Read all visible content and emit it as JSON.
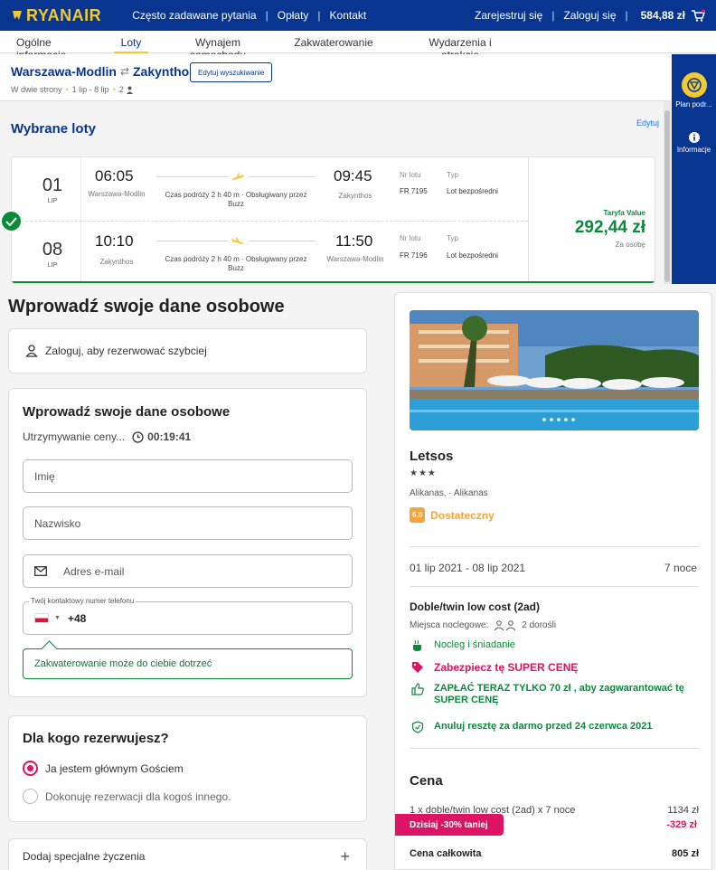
{
  "brand": {
    "name": "RYANAIR",
    "yellow": "#f1c933",
    "blue": "#073590"
  },
  "topnav": {
    "faq": "Często zadawane pytania",
    "fees": "Opłaty",
    "contact": "Kontakt",
    "register": "Zarejestruj się",
    "login": "Zaloguj się",
    "basket_total": "584,88 zł"
  },
  "tabs": [
    {
      "label": "Ogólne informacje"
    },
    {
      "label": "Loty"
    },
    {
      "label": "Wynajem samochodu"
    },
    {
      "label": "Zakwaterowanie"
    },
    {
      "label": "Wydarzenia i atrakcje"
    }
  ],
  "search": {
    "origin": "Warszawa-Modlin",
    "destination": "Zakynthos",
    "edit_label": "Edytuj wyszukiwanie",
    "trip_type": "W dwie strony",
    "dates": "1 lip - 8 lip",
    "passengers": "2"
  },
  "side": {
    "plan": "Plan podr...",
    "info": "Informacje"
  },
  "flights": {
    "title": "Wybrane loty",
    "edit": "Edytuj",
    "fare_name": "Taryfa Value",
    "fare_price": "292,44 zł",
    "fare_per": "Za osobę",
    "legs": [
      {
        "day": "01",
        "month": "LIP",
        "dep_time": "06:05",
        "dep_city": "Warszawa-Modlin",
        "duration": "Czas podróży 2 h 40 m · Obsługiwany przez Buzz",
        "arr_time": "09:45",
        "arr_city": "Zakynthos",
        "flight_label": "Nr lotu",
        "flight_no": "FR 7195",
        "type_label": "Typ",
        "type": "Lot bezpośredni"
      },
      {
        "day": "08",
        "month": "LIP",
        "dep_time": "10:10",
        "dep_city": "Zakynthos",
        "duration": "Czas podróży 2 h 40 m · Obsługiwany przez Buzz",
        "arr_time": "11:50",
        "arr_city": "Warszawa-Modlin",
        "flight_label": "Nr lotu",
        "flight_no": "FR 7196",
        "type_label": "Typ",
        "type": "Lot bezpośredni"
      }
    ]
  },
  "personal": {
    "heading": "Wprowadź swoje dane osobowe",
    "login_prompt": "Zaloguj, aby rezerwować szybciej",
    "form_title": "Wprowadź swoje dane osobowe",
    "hold_label": "Utrzymywanie ceny...",
    "hold_timer": "00:19:41",
    "first_name": "Imię",
    "last_name": "Nazwisko",
    "email": "Adres e-mail",
    "phone_label": "Twój kontaktowy numer telefonu",
    "phone_prefix": "+48",
    "notice": "Zakwaterowanie może do ciebie dotrzeć"
  },
  "booking_for": {
    "title": "Dla kogo rezerwujesz?",
    "option_main": "Ja jestem głównym Gościem",
    "option_other": "Dokonuję rezerwacji dla kogoś innego.",
    "selected": "main"
  },
  "special": {
    "label": "Dodaj specjalne życzenia"
  },
  "hotel": {
    "name": "Letsos",
    "stars": 3,
    "stars_text": "★★★",
    "location": "Alikanas, · Alikanas",
    "score": "6.0",
    "rating_text": "Dostateczny",
    "dates": "01 lip 2021 - 08 lip 2021",
    "nights": "7 noce",
    "room": "Doble/twin low cost (2ad)",
    "beds_label": "Miejsca noclegowe:",
    "beds_value": "2 dorośli",
    "board": "Nocleg i śniadanie",
    "price_promo": "Zabezpiecz tę SUPER CENĘ",
    "pay_now": "ZAPŁAĆ TERAZ TYLKO 70 zł , aby zagwarantować tę SUPER CENĘ",
    "cancel": "Anuluj resztę za darmo przed 24 czerwca 2021"
  },
  "price": {
    "title": "Cena",
    "line_label": "1 x doble/twin low cost (2ad) x 7 noce",
    "line_amount": "1134 zł",
    "discount_label": "Dzisiaj -30% taniej",
    "discount_amount": "-329 zł",
    "total_label": "Cena całkowita",
    "total_amount": "805 zł"
  }
}
